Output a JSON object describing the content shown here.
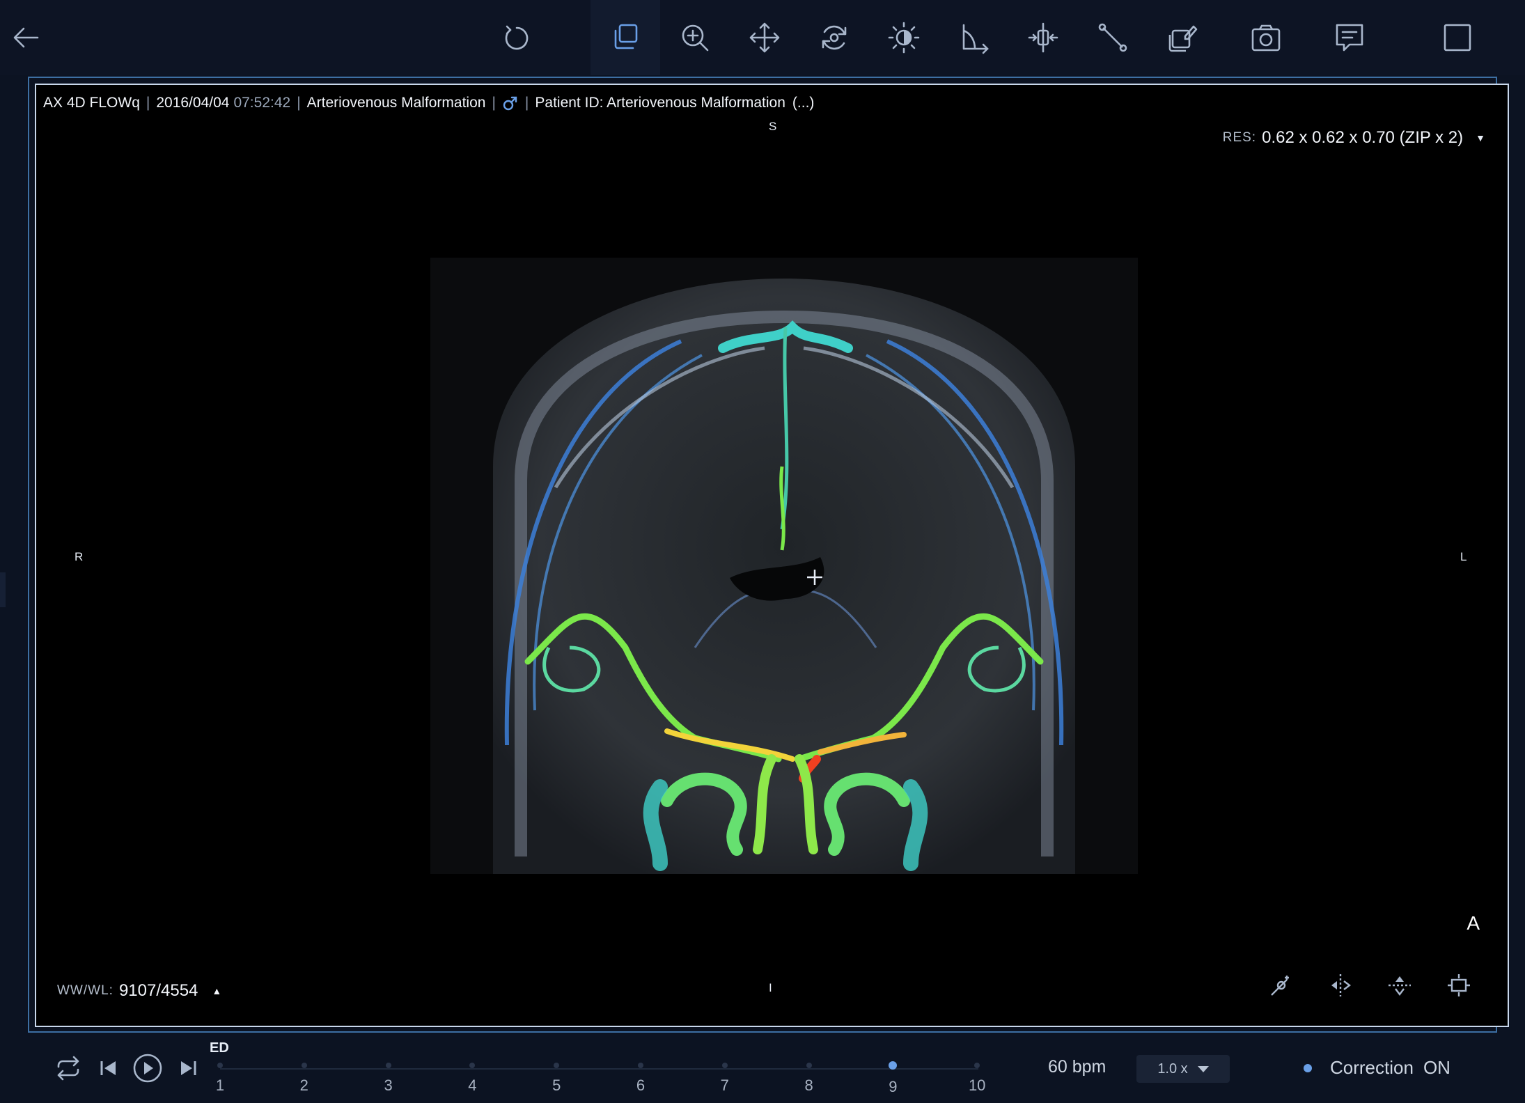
{
  "toolbar": {
    "tools": [
      {
        "name": "back-arrow-icon"
      },
      {
        "name": "reset-icon"
      },
      {
        "name": "copy-stack-icon"
      },
      {
        "name": "zoom-icon"
      },
      {
        "name": "pan-icon"
      },
      {
        "name": "rotate-3d-icon"
      },
      {
        "name": "brightness-icon"
      },
      {
        "name": "angle-icon"
      },
      {
        "name": "split-icon"
      },
      {
        "name": "measure-line-icon"
      },
      {
        "name": "layers-edit-icon"
      },
      {
        "name": "camera-icon"
      },
      {
        "name": "comment-icon"
      },
      {
        "name": "layout-square-icon"
      }
    ],
    "active_tool": "copy-stack-icon"
  },
  "info": {
    "series": "AX 4D FLOWq",
    "date": "2016/04/04",
    "time": "07:52:42",
    "study": "Arteriovenous Malformation",
    "gender_icon": "male-icon",
    "patient_id": "Patient ID: Arteriovenous Malformation",
    "more": "(...)"
  },
  "orientation": {
    "top": "S",
    "bottom": "I",
    "left": "R",
    "right": "L",
    "corner": "A"
  },
  "resolution": {
    "label": "RES:",
    "value": "0.62 x 0.62 x 0.70 (ZIP x 2)"
  },
  "window_level": {
    "label": "WW/WL:",
    "value": "9107/4554"
  },
  "viewport_tools": [
    {
      "name": "probe-icon"
    },
    {
      "name": "flip-horizontal-icon"
    },
    {
      "name": "flip-vertical-icon"
    },
    {
      "name": "fit-view-icon"
    }
  ],
  "playback": {
    "phase_label": "ED",
    "frames": [
      "1",
      "2",
      "3",
      "4",
      "5",
      "6",
      "7",
      "8",
      "9",
      "10"
    ],
    "current_frame": "9",
    "bpm": "60 bpm",
    "speed": "1.0 x",
    "correction_label": "Correction",
    "correction_state": "ON"
  },
  "colors": {
    "accent": "#6aa0e8",
    "background": "#0c1322",
    "viewport_border": "#c9d8ec"
  }
}
